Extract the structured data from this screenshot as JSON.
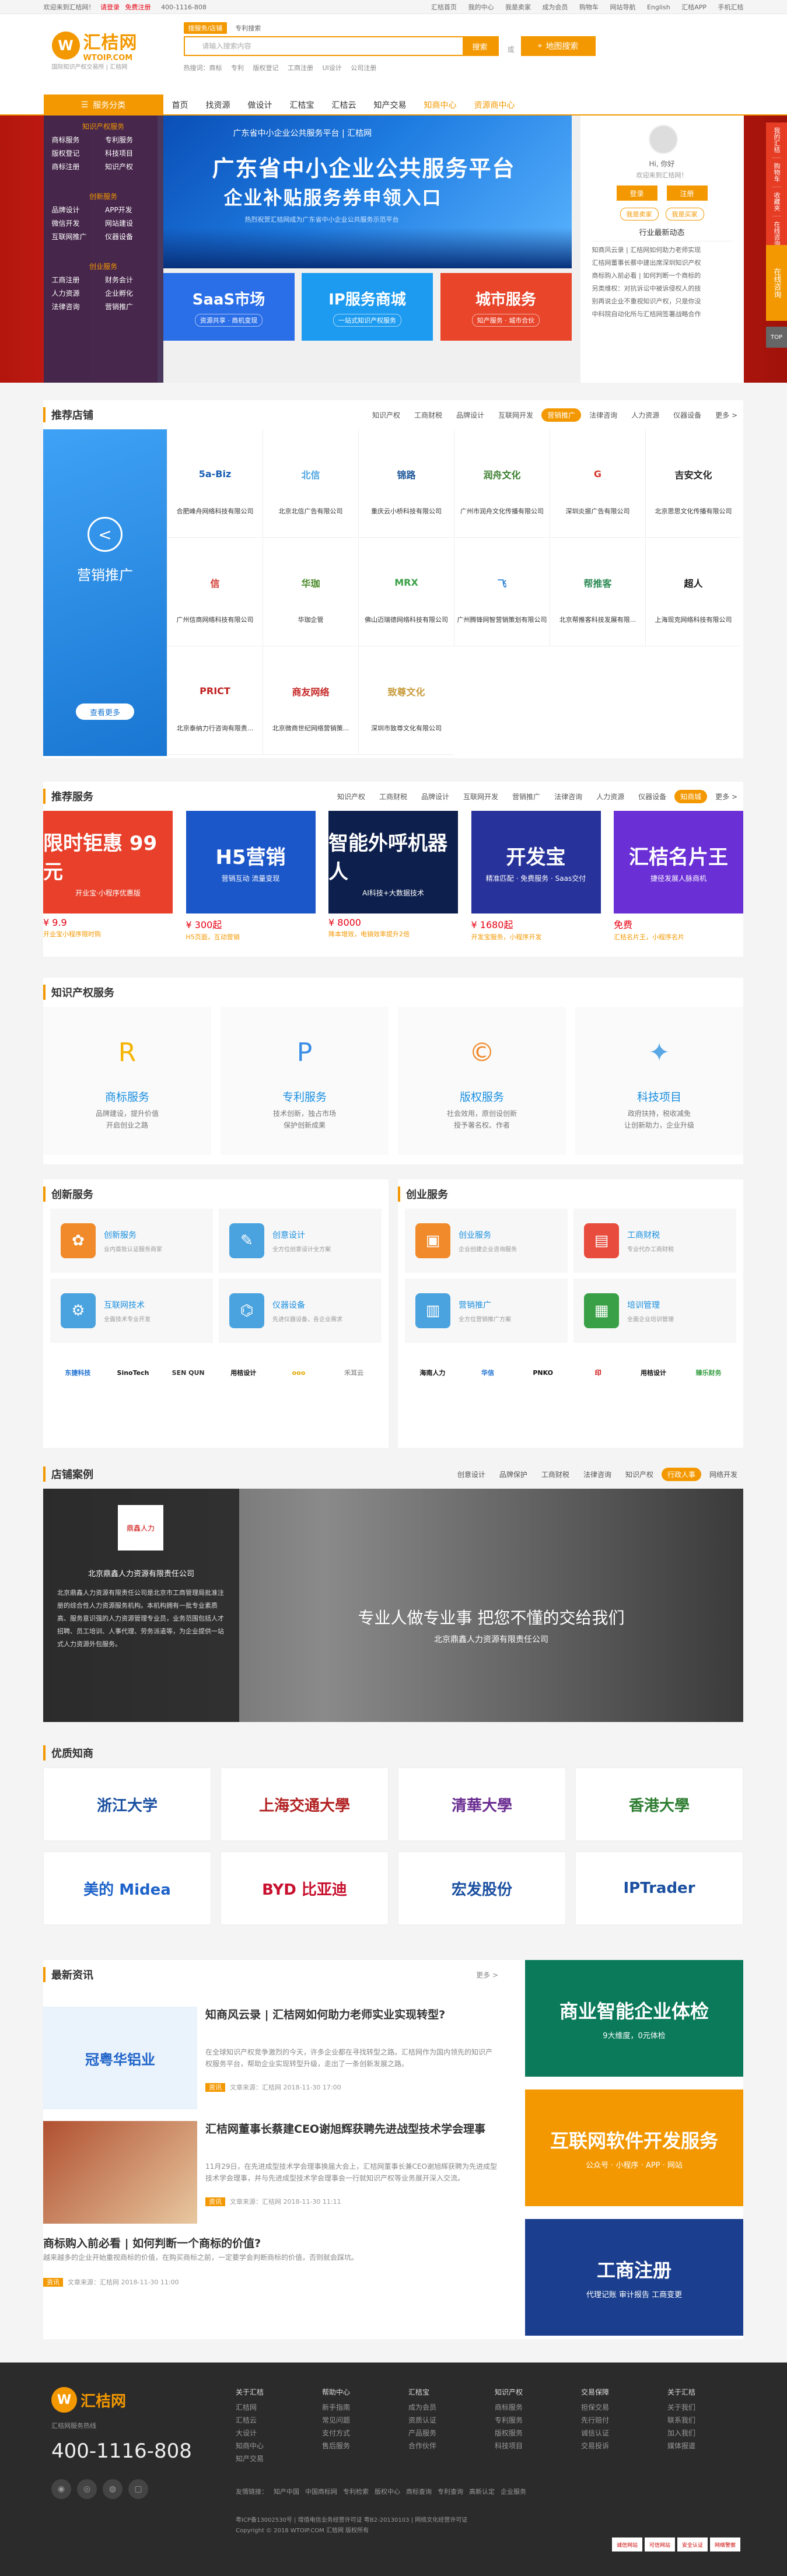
{
  "topbar": {
    "left": [
      "欢迎来到汇桔网！",
      "请登录",
      "免费注册"
    ],
    "hotline": "400-1116-808",
    "right": [
      "汇桔首页",
      "我的中心",
      "我是卖家",
      "成为会员",
      "购物车",
      "网站导航",
      "English",
      "汇桔APP",
      "手机汇桔"
    ]
  },
  "header": {
    "logo_mark": "W",
    "logo_name": "汇桔网",
    "logo_sub": "WTOIP.COM",
    "slogan": "国际知识产权交易所 | 汇桔网",
    "search_tabs": [
      "搜服务/店铺",
      "专利搜索"
    ],
    "search_placeholder": "请输入搜索内容",
    "search_button": "搜索",
    "or": "或",
    "map_button": "地图搜索",
    "hot_words": [
      "热搜词：商标",
      "专利",
      "版权登记",
      "工商注册",
      "UI设计",
      "公司注册"
    ]
  },
  "nav": {
    "category": "服务分类",
    "items": [
      "首页",
      "找资源",
      "做设计",
      "汇桔宝",
      "汇桔云",
      "知产交易",
      "知商中心",
      "资源商中心"
    ]
  },
  "sidebar": {
    "groups": [
      {
        "title": "知识产权服务",
        "items": [
          "商标服务",
          "专利服务",
          "版权登记",
          "科技项目",
          "商标注册",
          "知识产权"
        ]
      },
      {
        "title": "创新服务",
        "items": [
          "品牌设计",
          "APP开发",
          "微信开发",
          "网站建设",
          "互联网推广",
          "仪器设备"
        ]
      },
      {
        "title": "创业服务",
        "items": [
          "工商注册",
          "财务会计",
          "人力资源",
          "企业孵化",
          "法律咨询",
          "营销推广"
        ]
      }
    ]
  },
  "banner": {
    "top": "广东省中小企业公共服务平台 | 汇桔网",
    "title1": "广东省中小企业公共服务平台",
    "title2": "企业补贴服务券申领入口",
    "sub": "热烈祝贺汇桔网成为广东省中小企业公共服务示范平台"
  },
  "minis": [
    {
      "title": "SaaS市场",
      "sub": "资源共享 · 商机变现",
      "color": "#2a6ee8"
    },
    {
      "title": "IP服务商城",
      "sub": "一站式知识产权服务",
      "color": "#1d9bf0"
    },
    {
      "title": "城市服务",
      "sub": "知产服务 · 城市合伙",
      "color": "#e8452a"
    }
  ],
  "user": {
    "hello": "Hi, 你好",
    "welcome": "欢迎来到汇桔网！",
    "login": "登录",
    "register": "注册",
    "link1": "我是卖家",
    "link2": "我是买家",
    "news_title": "行业最新动态",
    "news": [
      "知商风云录 | 汇桔网如何助力老师实现",
      "汇桔网董事长蔡中建出席深圳知识产权",
      "商标购入前必看 | 如何判断一个商标的",
      "另类维权：对抗诉讼中被诉侵权人的技",
      "别再说企业不重视知识产权，只是你没",
      "中科院自动化所与汇桔网签署战略合作"
    ]
  },
  "floatbar": [
    "我的汇桔",
    "购物车",
    "收藏夹",
    "在线咨询"
  ],
  "float_consult": "在线咨询",
  "totop": "TOP",
  "shops": {
    "title": "推荐店铺",
    "tabs": [
      "知识产权",
      "工商财税",
      "品牌设计",
      "互联网开发",
      "营销推广",
      "法律咨询",
      "人力资源",
      "仪器设备",
      "更多 >"
    ],
    "active_tab": 4,
    "promo_title": "营销推广",
    "promo_button": "查看更多",
    "grid": [
      {
        "logo": "5a-Biz",
        "name": "合肥峰舟网络科技有限公司",
        "color": "#1a5fb4"
      },
      {
        "logo": "北信",
        "name": "北京北信广告有限公司",
        "color": "#4aa3df"
      },
      {
        "logo": "锦路",
        "name": "重庆云小桥科技有限公司",
        "color": "#1e5799"
      },
      {
        "logo": "润舟文化",
        "name": "广州市润舟文化传播有限公司",
        "color": "#3a7e2e"
      },
      {
        "logo": "G",
        "name": "深圳炎振广告有限公司",
        "color": "#d43a2f"
      },
      {
        "logo": "吉安文化",
        "name": "北京思思文化传播有限公司",
        "color": "#222"
      },
      {
        "logo": "信",
        "name": "广州信商网络科技有限公司",
        "color": "#d0322a"
      },
      {
        "logo": "华珈",
        "name": "华珈企管",
        "color": "#4c8b2b"
      },
      {
        "logo": "MRX",
        "name": "佛山迈瑞德网络科技有限公司",
        "color": "#3aa047"
      },
      {
        "logo": "飞",
        "name": "广州腾锋网智营销策划有限公司",
        "color": "#2a7fd4"
      },
      {
        "logo": "帮推客",
        "name": "北京帮推客科技发展有限...",
        "color": "#2e8b57"
      },
      {
        "logo": "超人",
        "name": "上海现克网络科技有限公司",
        "color": "#111"
      },
      {
        "logo": "PRICT",
        "name": "北京泰纳力行咨询有限责...",
        "color": "#c02020"
      },
      {
        "logo": "商友网络",
        "name": "北京微商世纪网络营销策...",
        "color": "#c62828"
      },
      {
        "logo": "致尊文化",
        "name": "深圳市致尊文化有限公司",
        "color": "#c89b3c"
      }
    ]
  },
  "services": {
    "title": "推荐服务",
    "tabs": [
      "知识产权",
      "工商财税",
      "品牌设计",
      "互联网开发",
      "营销推广",
      "法律咨询",
      "人力资源",
      "仪器设备",
      "知商城",
      "更多 >"
    ],
    "active_tab": 8,
    "items": [
      {
        "img_title": "限时钜惠 99元",
        "img_sub": "开业宝·小程序优惠版",
        "price": "¥ 9.9",
        "desc": "开业宝小程序限时购",
        "color": "#e8402a"
      },
      {
        "img_title": "H5营销",
        "img_sub": "营销互动 流量变现",
        "price": "¥ 300起",
        "desc": "H5页面，互动营销",
        "color": "#1c57c9"
      },
      {
        "img_title": "智能外呼机器人",
        "img_sub": "AI科技+大数据技术",
        "price": "¥ 8000",
        "desc": "降本增效，电销效率提升2倍",
        "color": "#0d1f4c"
      },
      {
        "img_title": "开发宝",
        "img_sub": "精准匹配 · 免费服务 · Saas交付",
        "price": "¥ 1680起",
        "desc": "开发宝服务，小程序开发",
        "color": "#27329a"
      },
      {
        "img_title": "汇桔名片王",
        "img_sub": "捷径发展人脉商机",
        "price": "免费",
        "desc": "汇桔名片王，小程序名片",
        "color": "#6b2fd6"
      }
    ]
  },
  "ip": {
    "title": "知识产权服务",
    "items": [
      {
        "title": "商标服务",
        "desc": "品牌建设，提升价值\n开启创业之路",
        "icon": "R",
        "color": "#f5b400"
      },
      {
        "title": "专利服务",
        "desc": "技术创新，独占市场\n保护创新成果",
        "icon": "P",
        "color": "#3a8ee6"
      },
      {
        "title": "版权服务",
        "desc": "社会效用，原创设创新\n授予署名权、作者",
        "icon": "©",
        "color": "#f08a2a"
      },
      {
        "title": "科技项目",
        "desc": "政府扶持，税收减免\n让创新助力，企业升级",
        "icon": "✦",
        "color": "#5aa7e6"
      }
    ]
  },
  "innovation": {
    "title": "创新服务",
    "items": [
      {
        "title": "创新服务",
        "desc": "业内首批认证服务商家",
        "icon": "✿",
        "color": "#f08a2a"
      },
      {
        "title": "创意设计",
        "desc": "全方位创意设计全方案",
        "icon": "✎",
        "color": "#4aa3df"
      },
      {
        "title": "互联网技术",
        "desc": "全面技术专业开发",
        "icon": "⚙",
        "color": "#4aa3df"
      },
      {
        "title": "仪器设备",
        "desc": "先进仪器设备，各企业需求",
        "icon": "⌬",
        "color": "#4aa3df"
      }
    ],
    "logos": [
      {
        "text": "东捷科技",
        "color": "#1a6fd1"
      },
      {
        "text": "SinoTech",
        "color": "#111"
      },
      {
        "text": "SEN QUN",
        "color": "#333"
      },
      {
        "text": "用桔设计",
        "color": "#111"
      },
      {
        "text": "ooo",
        "color": "#e0a800"
      },
      {
        "text": "禾耳云",
        "color": "#999"
      }
    ]
  },
  "startup": {
    "title": "创业服务",
    "items": [
      {
        "title": "创业服务",
        "desc": "企业创建企业咨询服务",
        "icon": "▣",
        "color": "#f08a2a"
      },
      {
        "title": "工商财税",
        "desc": "专业代办工商财税",
        "icon": "▤",
        "color": "#e74c3c"
      },
      {
        "title": "营销推广",
        "desc": "全方位营销推广方案",
        "icon": "▥",
        "color": "#4aa3df"
      },
      {
        "title": "培训管理",
        "desc": "全面企业培训管理",
        "icon": "▦",
        "color": "#3aa047"
      }
    ],
    "logos": [
      {
        "text": "海南人力",
        "color": "#111"
      },
      {
        "text": "华信",
        "color": "#1a6fd1"
      },
      {
        "text": "PNKO",
        "color": "#111"
      },
      {
        "text": "印",
        "color": "#c00"
      },
      {
        "text": "用桔设计",
        "color": "#111"
      },
      {
        "text": "臻乐财务",
        "color": "#3aa047"
      }
    ]
  },
  "cases": {
    "title": "店铺案例",
    "tabs": [
      "创意设计",
      "品牌保护",
      "工商财税",
      "法律咨询",
      "知识产权",
      "行政人事",
      "网络开发"
    ],
    "active_tab": 5,
    "company": "北京鼎鑫人力资源有限责任公司",
    "seal": "鼎鑫人力",
    "desc": "北京鼎鑫人力资源有限责任公司是北京市工商管理局批准注册的综合性人力资源服务机构。本机构拥有一批专业素质高、服务意识强的人力资源管理专业员，业务范围包括人才招聘、员工培训、人事代理、劳务派遣等，为企业提供一站式人力资源外包服务。",
    "slogan": "专业人做专业事 把您不懂的交给我们",
    "slogan_sub": "北京鼎鑫人力资源有限责任公司"
  },
  "brands": {
    "title": "优质知商",
    "items": [
      {
        "text": "浙江大学",
        "color": "#1a4fa0"
      },
      {
        "text": "上海交通大學",
        "color": "#b22222"
      },
      {
        "text": "清華大學",
        "color": "#6a2c91"
      },
      {
        "text": "香港大學",
        "color": "#2e7d32"
      },
      {
        "text": "美的 Midea",
        "color": "#1e63c9"
      },
      {
        "text": "BYD 比亚迪",
        "color": "#c8102e"
      },
      {
        "text": "宏发股份",
        "color": "#1a4fa0"
      },
      {
        "text": "IPTrader",
        "color": "#1a4fa0"
      }
    ]
  },
  "news": {
    "title": "最新资讯",
    "more": "更多 >",
    "items": [
      {
        "title": "知商风云录 | 汇桔网如何助力老师实业实现转型?",
        "body": "在全球知识产权竞争激烈的今天，许多企业都在寻找转型之路。汇桔网作为国内领先的知识产权服务平台，帮助企业实现转型升级，走出了一条创新发展之路。",
        "tag": "资讯",
        "meta": "文章来源：汇桔网   2018-11-30 17:00",
        "img": "冠粤华铝业",
        "color": "#1e63c9"
      },
      {
        "title": "汇桔网董事长蔡建CEO谢旭辉获聘先进战型技术学会理事",
        "body": "11月29日，在先进成型技术学会理事换届大会上，汇桔网董事长兼CEO谢旭辉获聘为先进成型技术学会理事，并与先进成型技术学会理事会一行就知识产权等业务展开深入交流。",
        "tag": "资讯",
        "meta": "文章来源：汇桔网   2018-11-30 11:11",
        "img": "",
        "color": "#c04a2a"
      },
      {
        "title": "商标购入前必看 | 如何判断一个商标的价值?",
        "body": "越来越多的企业开始重视商标的价值，在购买商标之前，一定要学会判断商标的价值，否则就会踩坑。",
        "tag": "资讯",
        "meta": "文章来源：汇桔网   2018-11-30 11:00",
        "img": "",
        "color": "#888"
      }
    ],
    "ads": [
      {
        "title": "商业智能企业体检",
        "sub": "9大维度，0元体检",
        "color": "#0a7a5a"
      },
      {
        "title": "互联网软件开发服务",
        "sub": "公众号 · 小程序 · APP · 网站",
        "color": "#f39800"
      },
      {
        "title": "工商注册",
        "sub": "代理记账 审计报告 工商变更",
        "color": "#1b3f8e"
      }
    ]
  },
  "footer": {
    "logo_mark": "W",
    "logo_name": "汇桔网",
    "sub": "汇桔网服务热线",
    "tel": "400-1116-808",
    "cols": [
      {
        "h": "关于汇桔",
        "items": [
          "汇桔网",
          "汇桔云",
          "大设计",
          "知商中心",
          "知产交易"
        ]
      },
      {
        "h": "帮助中心",
        "items": [
          "新手指南",
          "常见问题",
          "支付方式",
          "售后服务"
        ]
      },
      {
        "h": "汇桔宝",
        "items": [
          "成为会员",
          "资质认证",
          "产品服务",
          "合作伙伴"
        ]
      },
      {
        "h": "知识产权",
        "items": [
          "商标服务",
          "专利服务",
          "版权服务",
          "科技项目"
        ]
      },
      {
        "h": "交易保障",
        "items": [
          "担保交易",
          "先行赔付",
          "诚信认证",
          "交易投诉"
        ]
      },
      {
        "h": "关于汇桔",
        "items": [
          "关于我们",
          "联系我们",
          "加入我们",
          "媒体报道"
        ]
      }
    ],
    "links": [
      "友情链接：",
      "知产中国",
      "中国商标网",
      "专利检索",
      "版权中心",
      "商标查询",
      "专利查询",
      "高新认定",
      "企业服务"
    ],
    "copy1": "粤ICP备13002530号 | 增值电信业务经营许可证 粤B2-20130103 | 网络文化经营许可证",
    "copy2": "Copyright © 2018 WTOIP.COM 汇桔网 版权所有",
    "badges": [
      "诚信网站",
      "可信网站",
      "安全认证",
      "网络警察"
    ]
  }
}
